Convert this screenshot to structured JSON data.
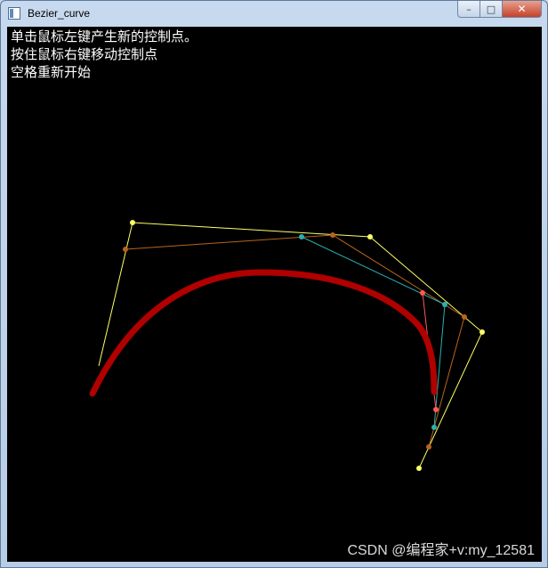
{
  "window": {
    "title": "Bezier_curve",
    "minimize_label": "–",
    "maximize_label": "□",
    "close_label": "✕"
  },
  "instructions": [
    "单击鼠标左键产生新的控制点。",
    "按住鼠标右键移动控制点",
    "空格重新开始"
  ],
  "watermark": "CSDN @编程家+v:my_12581",
  "colors": {
    "background": "#000000",
    "control_polygon": "#ffff66",
    "level_1": "#b8641e",
    "level_2": "#2ab0b0",
    "level_3": "#ff5a5a",
    "curve": "#b00000",
    "text": "#ffffff"
  }
}
